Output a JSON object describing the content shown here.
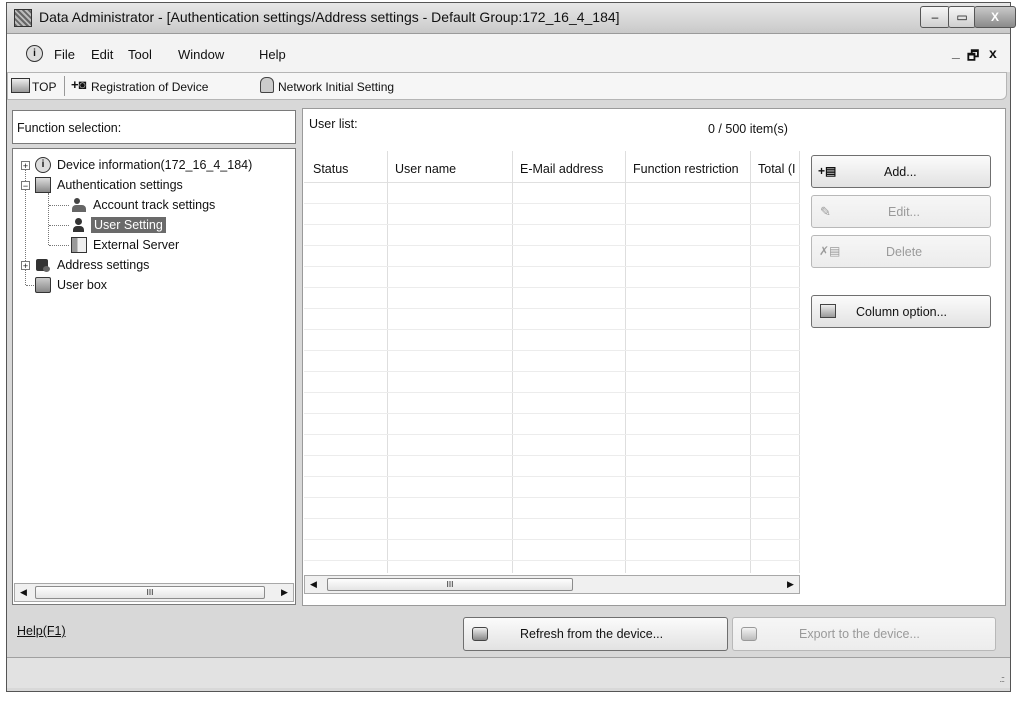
{
  "window": {
    "title": "Data Administrator - [Authentication settings/Address settings - Default Group:172_16_4_184]",
    "minimize_glyph": "–",
    "restore_glyph": "▭",
    "close_glyph": "X"
  },
  "menu": {
    "items": [
      "File",
      "Edit",
      "Tool",
      "Window",
      "Help"
    ],
    "mdi_minimize": "_",
    "mdi_restore": "🗗",
    "mdi_close": "x"
  },
  "toolbar": {
    "top_label": "TOP",
    "registration_label": "Registration of Device",
    "network_label": "Network Initial Setting"
  },
  "left_panel": {
    "title": "Function selection:",
    "tree": [
      {
        "label": "Device information(172_16_4_184)",
        "icon": "device-info-icon",
        "expander": "+"
      },
      {
        "label": "Authentication settings",
        "icon": "authentication-icon",
        "expander": "−"
      },
      {
        "label": "Account track settings",
        "icon": "account-track-icon"
      },
      {
        "label": "User Setting",
        "icon": "user-icon",
        "selected": true
      },
      {
        "label": "External Server",
        "icon": "external-server-icon"
      },
      {
        "label": "Address settings",
        "icon": "address-book-icon",
        "expander": "+"
      },
      {
        "label": "User box",
        "icon": "user-box-icon"
      }
    ],
    "scroll_mark": "III"
  },
  "user_list": {
    "title": "User list:",
    "count": "0 / 500 item(s)",
    "columns": [
      "Status",
      "User name",
      "E-Mail address",
      "Function restriction",
      "Total (I"
    ],
    "rows": [],
    "scroll_mark": "III"
  },
  "side_buttons": {
    "add": "Add...",
    "edit": "Edit...",
    "delete": "Delete",
    "column_option": "Column option..."
  },
  "footer": {
    "help": "Help(F1)",
    "refresh": "Refresh from the device...",
    "export": "Export to the device..."
  },
  "colors": {
    "selected_bg": "#6a6a6a",
    "frame": "#d8d8d8"
  }
}
